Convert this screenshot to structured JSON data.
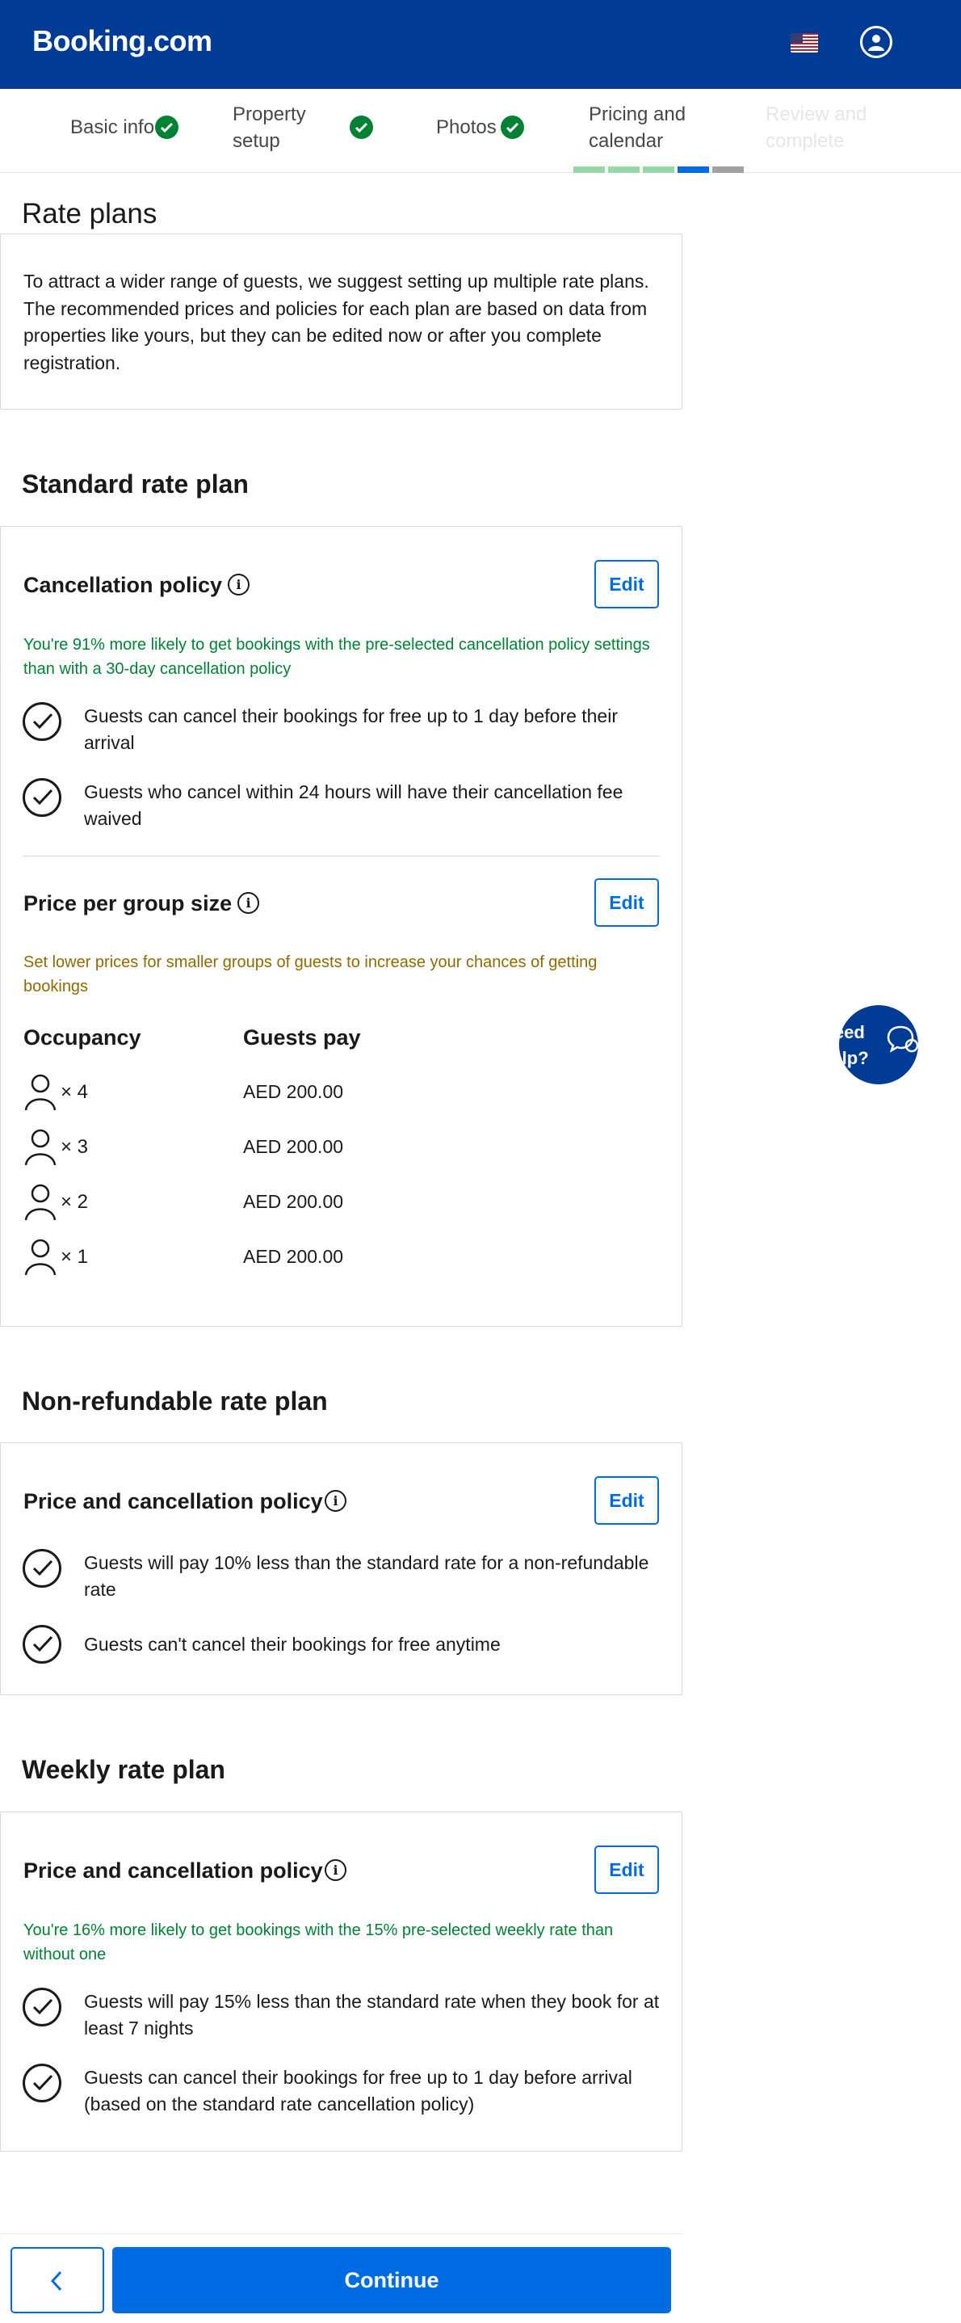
{
  "header": {
    "logo": "Booking.com",
    "flag_icon": "us-flag-icon",
    "account_icon": "user-icon"
  },
  "steps": [
    {
      "label": "Basic info",
      "status": "complete"
    },
    {
      "label": "Property setup",
      "status": "complete"
    },
    {
      "label": "Photos",
      "status": "complete"
    },
    {
      "label": "Pricing and calendar",
      "status": "current"
    },
    {
      "label": "Review and complete",
      "status": "upcoming"
    }
  ],
  "progress": {
    "segments_complete": 3,
    "segments_current": 1,
    "segments_total": 5
  },
  "colors": {
    "brand": "#003b95",
    "accent": "#006ce4",
    "success": "#008234",
    "warning": "#8f6b00"
  },
  "page_title": "Rate plans",
  "intro": "To attract a wider range of guests, we suggest setting up multiple rate plans. The recommended prices and policies for each plan are based on data from properties like yours, but they can be edited now or after you complete registration.",
  "standard": {
    "title": "Standard rate plan",
    "cancellation": {
      "title": "Cancellation policy",
      "edit_label": "Edit",
      "note": "You're 91% more likely to get bookings with the pre-selected cancellation policy settings than with a 30-day cancellation policy",
      "items": [
        "Guests can cancel their bookings for free up to 1 day before their arrival",
        "Guests who cancel within 24 hours will have their cancellation fee waived"
      ]
    },
    "group": {
      "title": "Price per group size",
      "edit_label": "Edit",
      "note": "Set lower prices for smaller groups of guests to increase your chances of getting bookings",
      "col_occupancy": "Occupancy",
      "col_guests_pay": "Guests pay",
      "rows": [
        {
          "occupancy": "× 4",
          "price": "AED 200.00"
        },
        {
          "occupancy": "× 3",
          "price": "AED 200.00"
        },
        {
          "occupancy": "× 2",
          "price": "AED 200.00"
        },
        {
          "occupancy": "× 1",
          "price": "AED 200.00"
        }
      ]
    }
  },
  "nonrefundable": {
    "title": "Non-refundable rate plan",
    "policy": {
      "title": "Price and cancellation policy",
      "edit_label": "Edit",
      "items": [
        "Guests will pay 10% less than the standard rate for a non-refundable rate",
        "Guests can't cancel their bookings for free anytime"
      ]
    }
  },
  "weekly": {
    "title": "Weekly rate plan",
    "policy": {
      "title": "Price and cancellation policy",
      "edit_label": "Edit",
      "note": "You're 16% more likely to get bookings with the 15% pre-selected weekly rate than without one",
      "items": [
        "Guests will pay 15% less than the standard rate when they book for at least 7 nights",
        "Guests can cancel their bookings for free up to 1 day before arrival (based on the standard rate cancellation policy)"
      ]
    }
  },
  "help": {
    "label": "Need help?"
  },
  "footer": {
    "continue_label": "Continue",
    "back_icon": "chevron-left-icon"
  }
}
